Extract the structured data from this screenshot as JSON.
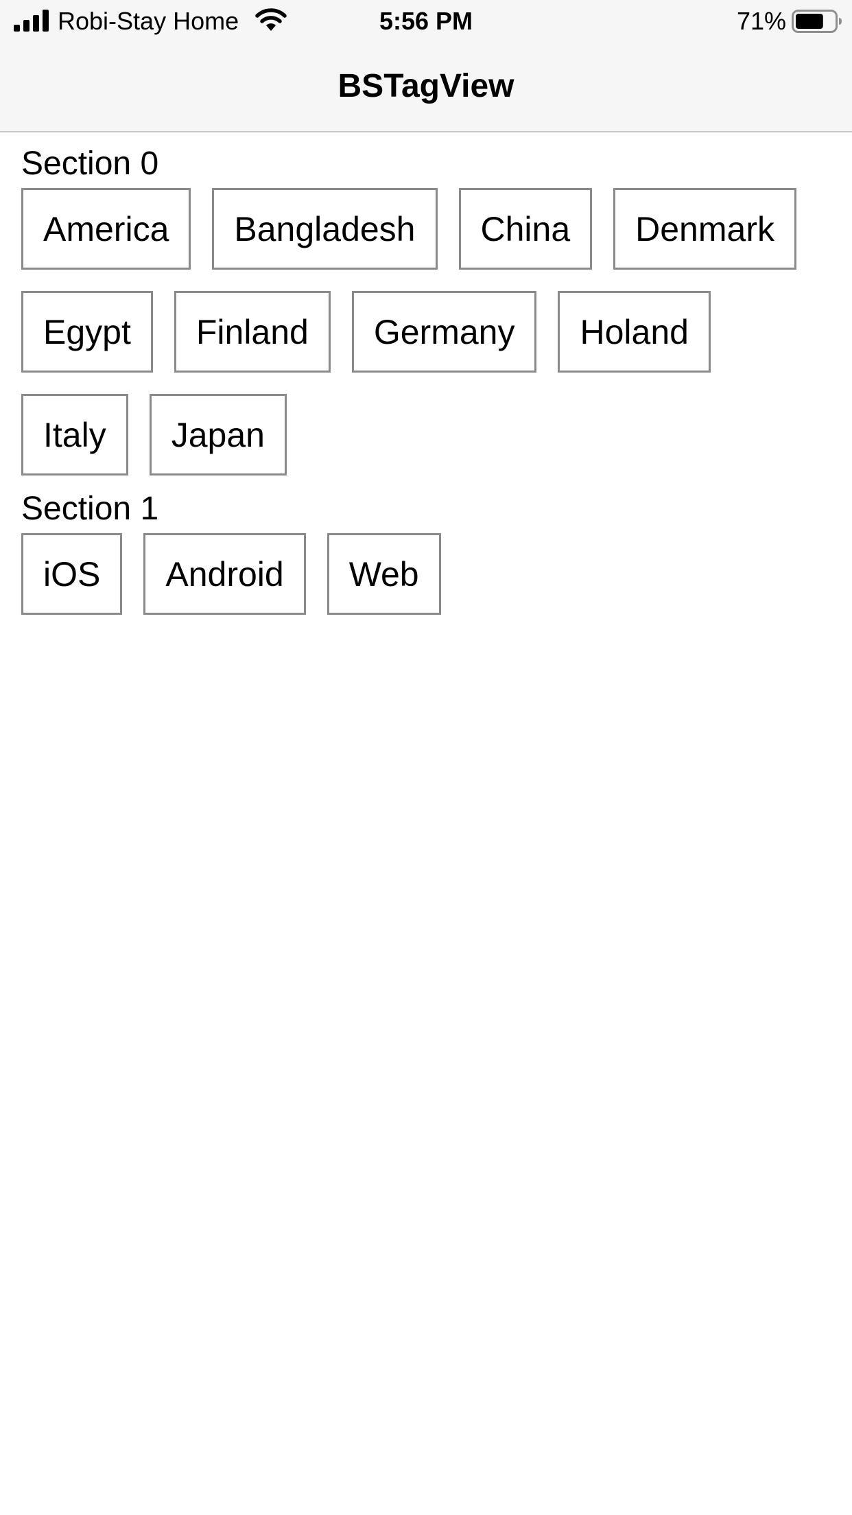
{
  "status_bar": {
    "carrier": "Robi-Stay Home",
    "time": "5:56 PM",
    "battery_percent": "71%",
    "battery_level": 0.71,
    "signal_bars": 4,
    "icons": [
      "signal-bars-icon",
      "wifi-icon",
      "battery-icon"
    ]
  },
  "nav": {
    "title": "BSTagView"
  },
  "sections": [
    {
      "title": "Section 0",
      "tags": [
        "America",
        "Bangladesh",
        "China",
        "Denmark",
        "Egypt",
        "Finland",
        "Germany",
        "Holand",
        "Italy",
        "Japan"
      ]
    },
    {
      "title": "Section 1",
      "tags": [
        "iOS",
        "Android",
        "Web"
      ]
    }
  ],
  "colors": {
    "bar_background": "#f6f6f6",
    "tag_border": "#8a8a8a",
    "separator": "#c8c8c8",
    "text": "#000000"
  }
}
